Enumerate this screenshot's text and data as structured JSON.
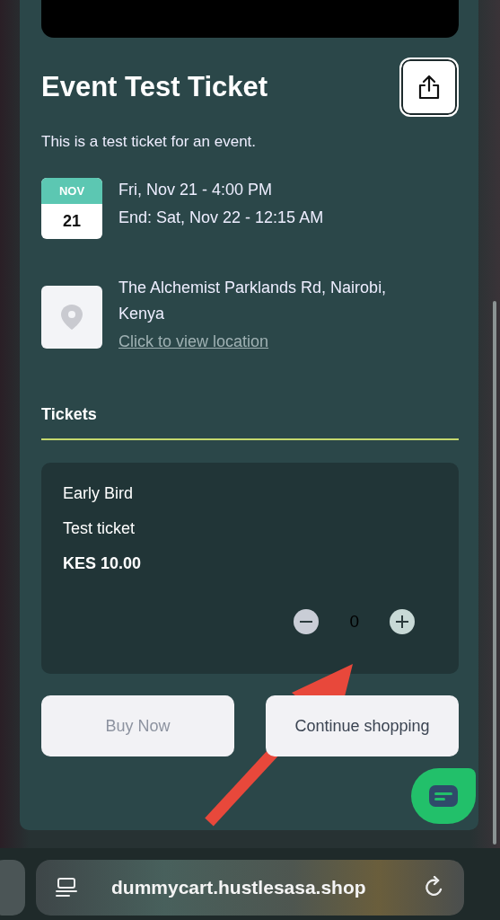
{
  "event": {
    "title": "Event Test Ticket",
    "description": "This is a test ticket for an event.",
    "date": {
      "month": "NOV",
      "day": "21",
      "start": "Fri, Nov 21 - 4:00 PM",
      "end": "End: Sat, Nov 22 - 12:15 AM"
    },
    "location": {
      "address": "The Alchemist Parklands Rd, Nairobi, Kenya",
      "link": "Click to view location"
    }
  },
  "tickets": {
    "heading": "Tickets",
    "items": [
      {
        "name": "Early Bird",
        "description": "Test ticket",
        "price": "KES 10.00",
        "quantity": "0",
        "minus_disabled": true
      }
    ]
  },
  "buttons": [
    {
      "label": "Buy Now",
      "disabled": true
    },
    {
      "label": "Continue shopping",
      "disabled": false
    }
  ],
  "browser": {
    "url": "dummycart.hustlesasa.shop"
  }
}
